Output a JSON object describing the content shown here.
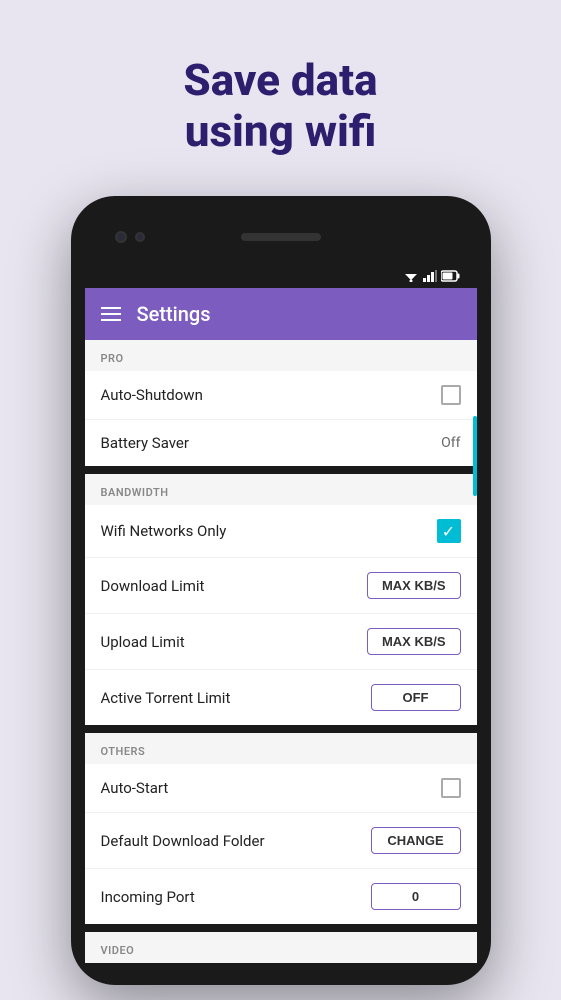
{
  "hero": {
    "title_line1": "Save data",
    "title_line2": "using wifi"
  },
  "status_bar": {
    "wifi_symbol": "▼",
    "signal_symbol": "▲",
    "battery_symbol": "▮"
  },
  "app_bar": {
    "title": "Settings"
  },
  "sections": [
    {
      "id": "pro",
      "header": "PRO",
      "rows": [
        {
          "id": "auto-shutdown",
          "label": "Auto-Shutdown",
          "control": "checkbox",
          "value": false
        },
        {
          "id": "battery-saver",
          "label": "Battery Saver",
          "control": "text",
          "value": "Off"
        }
      ]
    },
    {
      "id": "bandwidth",
      "header": "BANDWIDTH",
      "rows": [
        {
          "id": "wifi-networks-only",
          "label": "Wifi Networks Only",
          "control": "checkbox-checked",
          "value": true
        },
        {
          "id": "download-limit",
          "label": "Download Limit",
          "control": "button",
          "value": "MAX KB/S"
        },
        {
          "id": "upload-limit",
          "label": "Upload Limit",
          "control": "button",
          "value": "MAX KB/S"
        },
        {
          "id": "active-torrent-limit",
          "label": "Active Torrent Limit",
          "control": "button",
          "value": "OFF"
        }
      ]
    },
    {
      "id": "others",
      "header": "OTHERS",
      "rows": [
        {
          "id": "auto-start",
          "label": "Auto-Start",
          "control": "checkbox",
          "value": false
        },
        {
          "id": "default-download-folder",
          "label": "Default Download Folder",
          "control": "button",
          "value": "CHANGE"
        },
        {
          "id": "incoming-port",
          "label": "Incoming Port",
          "control": "button",
          "value": "0"
        }
      ]
    },
    {
      "id": "video",
      "header": "VIDEO",
      "rows": []
    }
  ]
}
